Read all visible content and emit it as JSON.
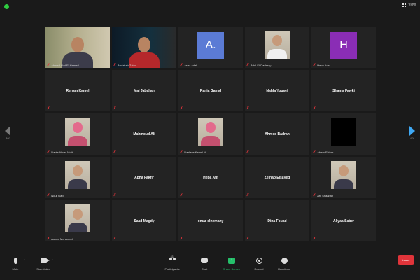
{
  "window": {
    "view_label": "View"
  },
  "nav": {
    "left_page": "1/2",
    "right_page": "2/2"
  },
  "tiles": [
    {
      "name": "Ahmed Abd El Hamed",
      "kind": "video1"
    },
    {
      "name": "Abdallah Zaied",
      "kind": "video2"
    },
    {
      "name": "Asaa Adel",
      "kind": "letter",
      "letter": "A.",
      "color": "#5b7bd5"
    },
    {
      "name": "Adel El-Dadaray",
      "kind": "photo-white"
    },
    {
      "name": "Heba Adel",
      "kind": "letter",
      "letter": "H",
      "color": "#8a2db5"
    },
    {
      "name": "Reham Kamel",
      "kind": "center"
    },
    {
      "name": "Mai Jabaliah",
      "kind": "center"
    },
    {
      "name": "Rania Gamal",
      "kind": "center"
    },
    {
      "name": "Nahla Yousef",
      "kind": "center"
    },
    {
      "name": "Shams Fawki",
      "kind": "center"
    },
    {
      "name": "Nahla Abdel-Motif...",
      "kind": "photo-hijab"
    },
    {
      "name": "Mahmoud Ali",
      "kind": "center"
    },
    {
      "name": "Nashwa Kamel M...",
      "kind": "photo-hijab"
    },
    {
      "name": "Ahmed Badran",
      "kind": "center"
    },
    {
      "name": "Abeer Elkhar",
      "kind": "photo-black"
    },
    {
      "name": "Nour Gad",
      "kind": "photo-person"
    },
    {
      "name": "Abha Fakrir",
      "kind": "center"
    },
    {
      "name": "Heba Atif",
      "kind": "center"
    },
    {
      "name": "Zeinab Elsayed",
      "kind": "center"
    },
    {
      "name": "Afif Shaaban",
      "kind": "photo-person"
    },
    {
      "name": "Ashraf Mohamed",
      "kind": "photo-person"
    },
    {
      "name": "Saad Magdy",
      "kind": "center"
    },
    {
      "name": "omar elnemany",
      "kind": "center"
    },
    {
      "name": "Dina Fouad",
      "kind": "center"
    },
    {
      "name": "Aliyaa Saber",
      "kind": "center"
    }
  ],
  "toolbar": {
    "mute": "Mute",
    "stop_video": "Stop Video",
    "participants": "Participants",
    "participants_count": "41",
    "chat": "Chat",
    "share_screen": "Share Screen",
    "record": "Record",
    "reactions": "Reactions",
    "leave": "Leave"
  },
  "colors": {
    "accent_green": "#25c06a",
    "leave_red": "#e0343a",
    "active_speaker": "#e3d44a",
    "nav_blue": "#3fa9f5"
  }
}
